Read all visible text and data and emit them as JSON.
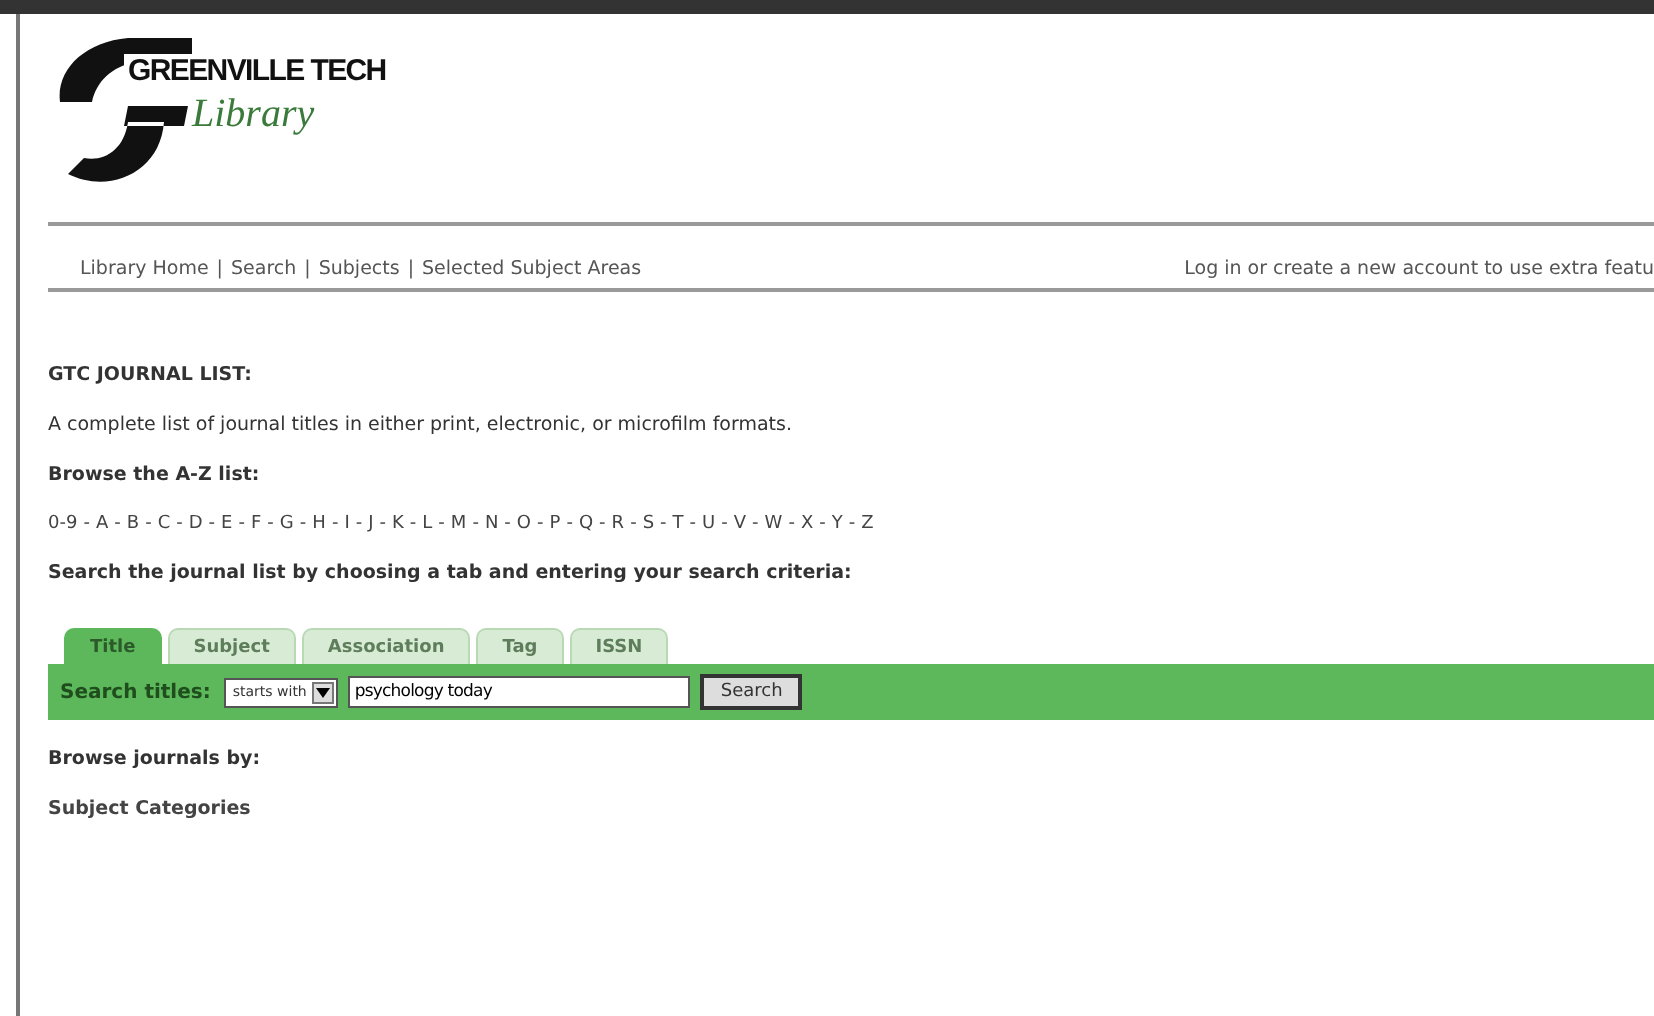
{
  "header": {
    "logo_title": "GREENVILLE TECH",
    "logo_subtitle": "Library"
  },
  "nav": {
    "links": [
      "Library Home",
      "Search",
      "Subjects",
      "Selected Subject Areas"
    ],
    "separator": "|",
    "login_note": "Log in or create a new account to use extra featu"
  },
  "heading": "GTC JOURNAL LIST:",
  "description": "A complete list of journal titles in either print, electronic, or microfilm formats.",
  "browse_label": "Browse the A-Z list:",
  "az": {
    "letters": [
      "0-9",
      "A",
      "B",
      "C",
      "D",
      "E",
      "F",
      "G",
      "H",
      "I",
      "J",
      "K",
      "L",
      "M",
      "N",
      "O",
      "P",
      "Q",
      "R",
      "S",
      "T",
      "U",
      "V",
      "W",
      "X",
      "Y",
      "Z"
    ],
    "separator": "-"
  },
  "search_intro": "Search the journal list by choosing a tab and entering your search criteria:",
  "tabs": [
    {
      "label": "Title",
      "selected": true
    },
    {
      "label": "Subject",
      "selected": false
    },
    {
      "label": "Association",
      "selected": false
    },
    {
      "label": "Tag",
      "selected": false
    },
    {
      "label": "ISSN",
      "selected": false
    }
  ],
  "search": {
    "label": "Search titles:",
    "mode": "starts with",
    "value": "psychology today",
    "button": "Search"
  },
  "browse_by": "Browse journals by:",
  "categories_link": "Subject Categories"
}
